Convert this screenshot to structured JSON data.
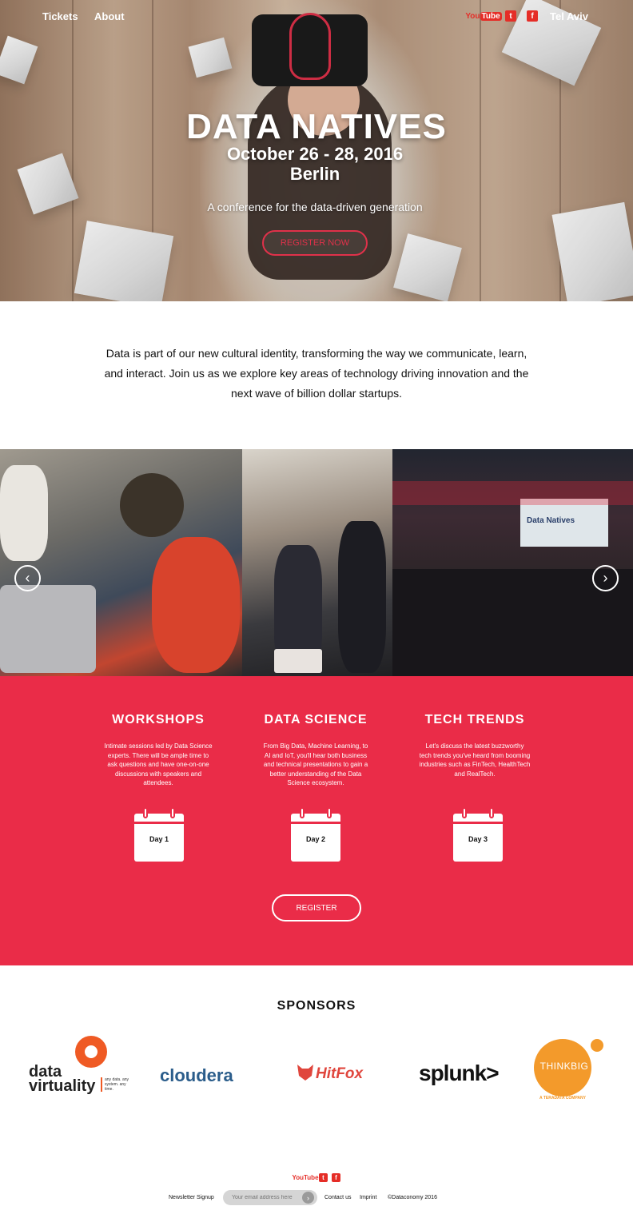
{
  "nav": {
    "tickets": "Tickets",
    "about": "About",
    "youtube_you": "You",
    "youtube_tube": "Tube",
    "twitter": "t",
    "facebook": "f",
    "city": "Tel Aviv"
  },
  "hero": {
    "title": "DATA NATIVES",
    "date": "October 26 - 28, 2016",
    "city": "Berlin",
    "tagline": "A conference for the data-driven generation",
    "register": "REGISTER NOW"
  },
  "intro": {
    "text": "Data is part of our new cultural identity, transforming the way we communicate, learn, and interact. Join us as we explore key areas of technology driving innovation and the next wave of  billion dollar startups."
  },
  "gallery": {
    "screen_text": "Data Natives",
    "prev": "‹",
    "next": "›"
  },
  "tracks": [
    {
      "title": "WORKSHOPS",
      "description": "Intimate sessions led by Data Science experts. There will be ample time to ask questions and have one-on-one discussions with speakers and attendees.",
      "day": "Day 1"
    },
    {
      "title": "DATA SCIENCE",
      "description": "From Big Data, Machine Learning, to AI and IoT, you'll hear both business and technical presentations to gain a better understanding of the Data Science ecosystem.",
      "day": "Day 2"
    },
    {
      "title": "TECH TRENDS",
      "description": "Let's discuss the latest buzzworthy tech trends you've heard from booming industries such as FinTech, HealthTech and RealTech.",
      "day": "Day 3"
    }
  ],
  "register_button": "REGISTER",
  "sponsors": {
    "title": "SPONSORS",
    "data_virtuality": {
      "line1": "data",
      "line2": "virtuality",
      "tagline": "any data. any system. any time."
    },
    "cloudera": "cloudera",
    "hitfox": "HitFox",
    "splunk": "splunk>",
    "thinkbig": {
      "name": "THINKBIG",
      "sub": "A TERADATA COMPANY"
    }
  },
  "footer": {
    "youtube": "YouTube",
    "twitter": "t",
    "facebook": "f",
    "newsletter_label": "Newsletter Signup",
    "email_placeholder": "Your email address here",
    "submit": "›",
    "contact": "Contact us",
    "imprint": "Imprint",
    "copyright": "©Dataconomy 2016"
  },
  "colors": {
    "accent": "#ea2c48",
    "hero_button": "#e0314a",
    "youtube_red": "#e52d27"
  }
}
